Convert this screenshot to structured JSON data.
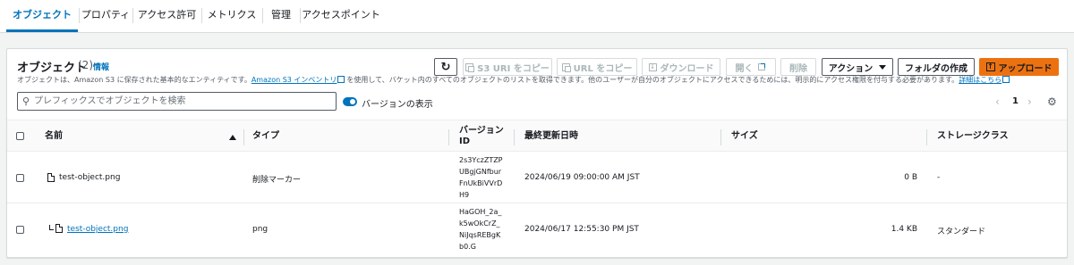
{
  "tabs": [
    "オブジェクト",
    "プロパティ",
    "アクセス許可",
    "メトリクス",
    "管理",
    "アクセスポイント"
  ],
  "panel": {
    "title": "オブジェクト",
    "count": "(2)",
    "info": "情報",
    "desc_part1": "オブジェクトは、Amazon S3 に保存された基本的なエンティティです。",
    "desc_link1": "Amazon S3 インベントリ",
    "desc_part2": "を使用して、バケット内のすべてのオブジェクトのリストを取得できます。他のユーザーが自分のオブジェクトにアクセスできるためには、明示的にアクセス権限を付与する必要があります。",
    "desc_link2": "詳細はこちら"
  },
  "toolbar": {
    "refresh": "↻",
    "copy_s3_uri": "S3 URI をコピー",
    "copy_url": "URL をコピー",
    "download": "ダウンロード",
    "open": "開く",
    "delete": "削除",
    "actions": "アクション",
    "create_folder": "フォルダの作成",
    "upload": "アップロード"
  },
  "search": {
    "placeholder": "プレフィックスでオブジェクトを検索"
  },
  "versions_toggle": {
    "label": "バージョンの表示",
    "on": true
  },
  "pagination": {
    "page": "1"
  },
  "table": {
    "headers": {
      "name": "名前",
      "type": "タイプ",
      "version_l1": "バージョン",
      "version_l2": "ID",
      "modified": "最終更新日時",
      "size": "サイズ",
      "storage": "ストレージクラス"
    },
    "rows": [
      {
        "name": "test-object.png",
        "type": "削除マーカー",
        "version": [
          "2s3YczZTZP",
          "UBgjGNfbur",
          "FnUkBiVVrD",
          "H9"
        ],
        "modified": "2024/06/19 09:00:00 AM JST",
        "size": "0 B",
        "storage": "-"
      },
      {
        "name": "test-object.png",
        "type": "png",
        "version": [
          "HaGOH_2a_",
          "k5wOkCrZ_",
          "NiJqsREBgK",
          "b0.G"
        ],
        "modified": "2024/06/17 12:55:30 PM JST",
        "size": "1.4 KB",
        "storage": "スタンダード"
      }
    ]
  },
  "colors": {
    "accent": "#0073bb",
    "primary": "#ec7211",
    "border": "#d5dbdb"
  },
  "icons": [
    "refresh-icon",
    "copy-icon",
    "download-icon",
    "external-link-icon",
    "caret-down-icon",
    "upload-icon",
    "search-icon",
    "sort-up-icon",
    "file-icon",
    "chevron-left-icon",
    "chevron-right-icon",
    "gear-icon"
  ]
}
